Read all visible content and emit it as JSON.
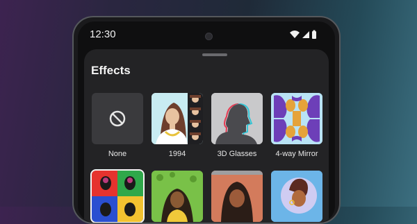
{
  "status_bar": {
    "time": "12:30"
  },
  "sheet": {
    "title": "Effects"
  },
  "effects": [
    {
      "label": "None"
    },
    {
      "label": "1994"
    },
    {
      "label": "3D Glasses"
    },
    {
      "label": "4-way Mirror"
    }
  ],
  "colors": {
    "accent": "#6d3fb8",
    "sheet_bg": "#232325"
  }
}
